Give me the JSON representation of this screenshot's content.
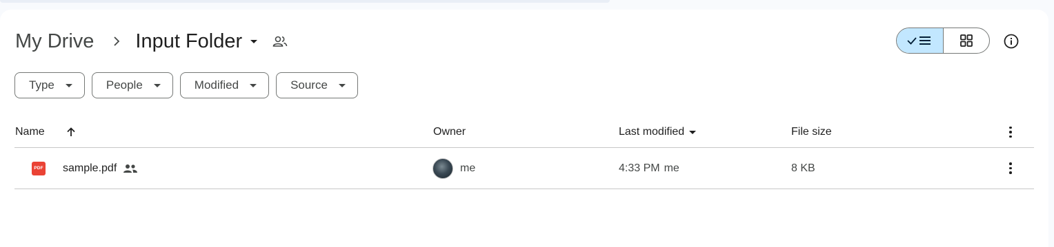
{
  "breadcrumb": {
    "root": "My Drive",
    "current": "Input Folder"
  },
  "filters": [
    {
      "label": "Type"
    },
    {
      "label": "People"
    },
    {
      "label": "Modified"
    },
    {
      "label": "Source"
    }
  ],
  "table": {
    "columns": {
      "name": "Name",
      "owner": "Owner",
      "last_modified": "Last modified",
      "file_size": "File size"
    },
    "rows": [
      {
        "file_type_icon": "PDF",
        "name": "sample.pdf",
        "owner": "me",
        "modified_time": "4:33 PM",
        "modified_by": "me",
        "size": "8 KB"
      }
    ]
  },
  "colors": {
    "accent_toggle": "#c2e7ff",
    "pdf_red": "#ea4335",
    "background": "#f8fafd"
  },
  "icons": [
    "chevron-right-icon",
    "shared-folder-icon",
    "list-view-icon",
    "grid-view-icon",
    "info-icon",
    "arrow-up-icon",
    "more-vert-icon",
    "people-icon"
  ]
}
